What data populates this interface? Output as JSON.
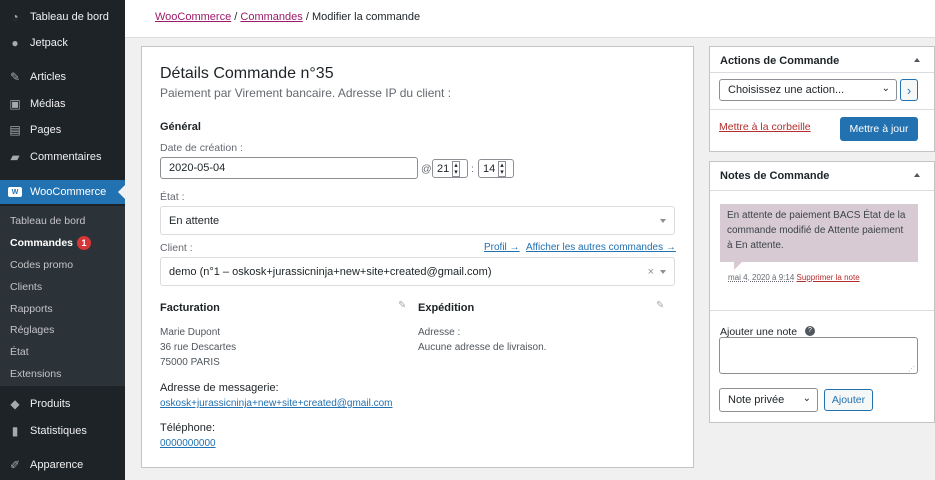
{
  "sidebar": {
    "top_items": [
      {
        "label": "Tableau de bord",
        "icon": "dashboard-icon"
      },
      {
        "label": "Jetpack",
        "icon": "jetpack-icon"
      },
      {
        "label": "Articles",
        "icon": "pin-icon"
      },
      {
        "label": "Médias",
        "icon": "media-icon"
      },
      {
        "label": "Pages",
        "icon": "pages-icon"
      },
      {
        "label": "Commentaires",
        "icon": "comments-icon"
      }
    ],
    "woocommerce": {
      "label": "WooCommerce",
      "icon": "woocommerce-icon"
    },
    "submenu": [
      {
        "label": "Tableau de bord"
      },
      {
        "label": "Commandes",
        "badge": "1"
      },
      {
        "label": "Codes promo"
      },
      {
        "label": "Clients"
      },
      {
        "label": "Rapports"
      },
      {
        "label": "Réglages"
      },
      {
        "label": "État"
      },
      {
        "label": "Extensions"
      }
    ],
    "bottom_items": [
      {
        "label": "Produits",
        "icon": "products-icon"
      },
      {
        "label": "Statistiques",
        "icon": "stats-icon"
      },
      {
        "label": "Apparence",
        "icon": "appearance-icon"
      }
    ]
  },
  "breadcrumb": {
    "woocommerce": "WooCommerce",
    "sep1": "/",
    "commandes": "Commandes",
    "sep2": "/",
    "current": "Modifier la commande"
  },
  "order": {
    "title": "Détails Commande n°35",
    "subtitle": "Paiement par Virement bancaire. Adresse IP du client :",
    "general_heading": "Général",
    "date_label": "Date de création :",
    "date_value": "2020-05-04",
    "at": "@",
    "hour": "21",
    "colon": ":",
    "minute": "14",
    "status_label": "État :",
    "status_value": "En attente",
    "client_label": "Client :",
    "profile_link": "Profil →",
    "other_orders_link": "Afficher les autres commandes →",
    "client_value": "demo (n°1 – oskosk+jurassicninja+new+site+created@gmail.com)",
    "clear_symbol": "×",
    "billing": {
      "heading": "Facturation",
      "address_lines": "Marie Dupont\n36 rue Descartes\n75000 PARIS",
      "email_label": "Adresse de messagerie:",
      "email": "oskosk+jurassicninja+new+site+created@gmail.com",
      "phone_label": "Téléphone:",
      "phone": "0000000000"
    },
    "shipping": {
      "heading": "Expédition",
      "address_label": "Adresse :",
      "address_value": "Aucune adresse de livraison."
    }
  },
  "actions": {
    "heading": "Actions de Commande",
    "select_value": "Choisissez une action...",
    "go_symbol": "›",
    "trash_link": "Mettre à la corbeille",
    "update_button": "Mettre à jour"
  },
  "notes": {
    "heading": "Notes de Commande",
    "note_text": "En attente de paiement BACS État de la commande modifié de Attente paiement à En attente.",
    "note_date": "mai 4, 2020 à 9:14",
    "delete_link": "Supprimer la note",
    "add_label": "Ajouter une note",
    "help_symbol": "?",
    "note_type": "Note privée",
    "add_button": "Ajouter"
  },
  "colors": {
    "sidebar_bg": "#1d2327",
    "accent": "#2271b1",
    "woo_purple": "#9b1b6b",
    "note_bg": "#d7cad2",
    "badge": "#d63638"
  }
}
